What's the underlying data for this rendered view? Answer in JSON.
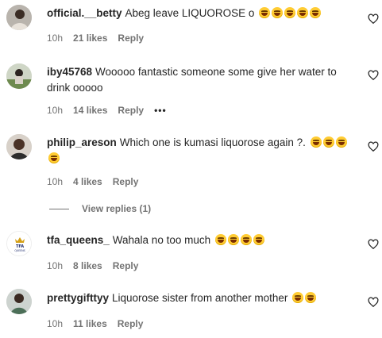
{
  "heart_color": "#262626",
  "meta_color": "#737373",
  "comments": [
    {
      "username": "official.__betty",
      "text": "Abeg leave LIQUOROSE o",
      "emojis": 5,
      "time": "10h",
      "likes": "21 likes",
      "reply": "Reply",
      "avatar_icon": "avatar-photo-icon"
    },
    {
      "username": "iby45768",
      "text": "Wooooo fantastic someone some give her water to drink ooooo",
      "emojis": 0,
      "time": "10h",
      "likes": "14 likes",
      "reply": "Reply",
      "more": "•••",
      "avatar_icon": "avatar-photo-icon"
    },
    {
      "username": "philip_areson",
      "text": "Which one is kumasi liquorose again ?.",
      "emojis": 4,
      "time": "10h",
      "likes": "4 likes",
      "reply": "Reply",
      "view_replies": "View replies (1)",
      "avatar_icon": "avatar-photo-icon"
    },
    {
      "username": "tfa_queens_",
      "text": "Wahala no too much",
      "emojis": 4,
      "time": "10h",
      "likes": "8 likes",
      "reply": "Reply",
      "avatar_icon": "tfa-logo-icon",
      "avatar_logo_text": "TFA QUEENS"
    },
    {
      "username": "prettygifttyy",
      "text": "Liquorose sister from another mother",
      "emojis": 2,
      "time": "10h",
      "likes": "11 likes",
      "reply": "Reply",
      "avatar_icon": "avatar-photo-icon"
    }
  ]
}
